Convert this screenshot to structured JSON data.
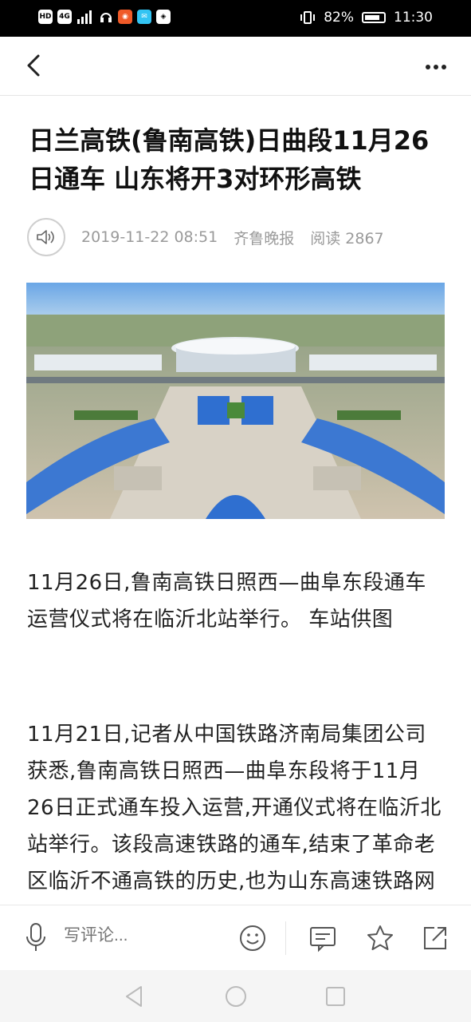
{
  "status_bar": {
    "left_icons": [
      "HD",
      "4G",
      "signal",
      "headset",
      "app-icon-1",
      "app-icon-2",
      "app-icon-3"
    ],
    "battery_percent": "82%",
    "time": "11:30"
  },
  "article": {
    "title": "日兰高铁(鲁南高铁)日曲段11月26日通车 山东将开3对环形高铁",
    "date": "2019-11-22 08:51",
    "source": "齐鲁晚报",
    "reads": "阅读 2867",
    "paragraphs": [
      "11月26日,鲁南高铁日照西—曲阜东段通车运营仪式将在临沂北站举行。 车站供图",
      "11月21日,记者从中国铁路济南局集团公司获悉,鲁南高铁日照西—曲阜东段将于11月26日正式通车投入运营,开通仪式将在临沂北站举行。该段高速铁路的通车,结束了革命老区临沂不通高铁的历史,也为山东高速铁路网新增一条“横线”打io"
    ]
  },
  "bottom_bar": {
    "comment_placeholder": "写评论..."
  },
  "colors": {
    "meta_gray": "#9a9a9a",
    "status_bg": "#000000",
    "sky": "#87b8e8"
  }
}
